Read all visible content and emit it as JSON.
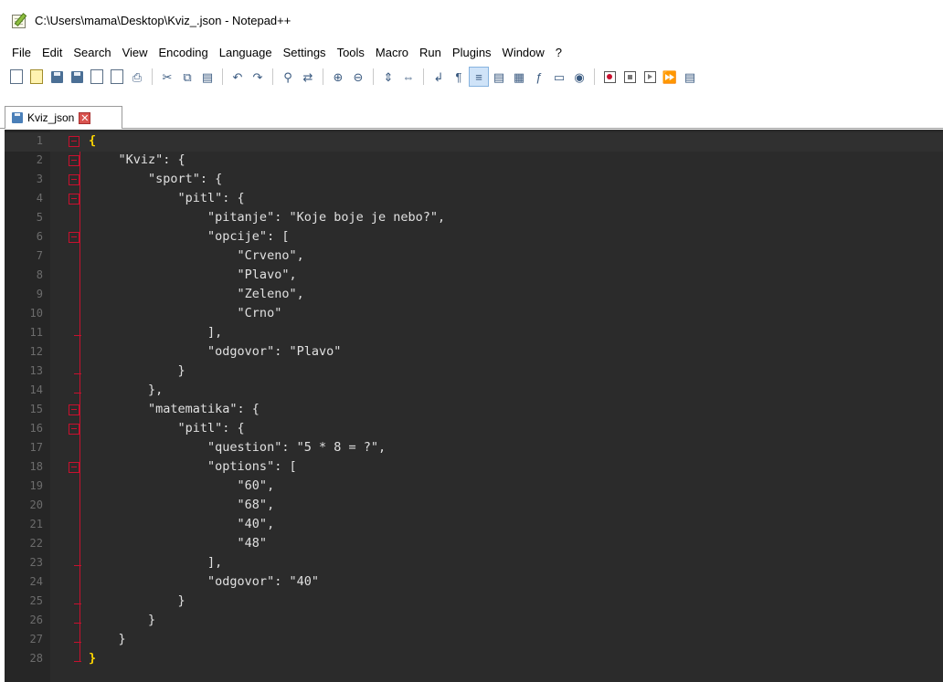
{
  "window": {
    "title": "C:\\Users\\mama\\Desktop\\Kviz_.json - Notepad++"
  },
  "menu": [
    "File",
    "Edit",
    "Search",
    "View",
    "Encoding",
    "Language",
    "Settings",
    "Tools",
    "Macro",
    "Run",
    "Plugins",
    "Window",
    "?"
  ],
  "toolbar": {
    "icons": [
      "new-file-icon",
      "open-file-icon",
      "save-icon",
      "save-all-icon",
      "close-icon",
      "close-all-icon",
      "print-icon",
      "cut-icon",
      "copy-icon",
      "paste-icon",
      "undo-icon",
      "redo-icon",
      "find-icon",
      "replace-icon",
      "zoom-in-icon",
      "zoom-out-icon",
      "sync-vertical-icon",
      "sync-horizontal-icon",
      "word-wrap-icon",
      "show-all-chars-icon",
      "indent-guide-icon",
      "user-language-icon",
      "document-map-icon",
      "function-list-icon",
      "folder-workspace-icon",
      "monitoring-icon",
      "record-macro-icon",
      "stop-recording-icon",
      "playback-macro-icon",
      "run-macro-multiple-icon",
      "save-macro-icon"
    ]
  },
  "tab": {
    "label": "Kviz_json",
    "close": "✕"
  },
  "editor": {
    "lines": [
      {
        "num": "1",
        "text": "{",
        "fold": "open"
      },
      {
        "num": "2",
        "text": "    \"Kviz\": {",
        "fold": "open"
      },
      {
        "num": "3",
        "text": "        \"sport\": {",
        "fold": "open"
      },
      {
        "num": "4",
        "text": "            \"pitl\": {",
        "fold": "open"
      },
      {
        "num": "5",
        "text": "                \"pitanje\": \"Koje boje je nebo?\",",
        "fold": ""
      },
      {
        "num": "6",
        "text": "                \"opcije\": [",
        "fold": "open"
      },
      {
        "num": "7",
        "text": "                    \"Crveno\",",
        "fold": ""
      },
      {
        "num": "8",
        "text": "                    \"Plavo\",",
        "fold": ""
      },
      {
        "num": "9",
        "text": "                    \"Zeleno\",",
        "fold": ""
      },
      {
        "num": "10",
        "text": "                    \"Crno\"",
        "fold": ""
      },
      {
        "num": "11",
        "text": "                ],",
        "fold": "end"
      },
      {
        "num": "12",
        "text": "                \"odgovor\": \"Plavo\"",
        "fold": ""
      },
      {
        "num": "13",
        "text": "            }",
        "fold": "end"
      },
      {
        "num": "14",
        "text": "        },",
        "fold": "end"
      },
      {
        "num": "15",
        "text": "        \"matematika\": {",
        "fold": "open"
      },
      {
        "num": "16",
        "text": "            \"pitl\": {",
        "fold": "open"
      },
      {
        "num": "17",
        "text": "                \"question\": \"5 * 8 = ?\",",
        "fold": ""
      },
      {
        "num": "18",
        "text": "                \"options\": [",
        "fold": "open"
      },
      {
        "num": "19",
        "text": "                    \"60\",",
        "fold": ""
      },
      {
        "num": "20",
        "text": "                    \"68\",",
        "fold": ""
      },
      {
        "num": "21",
        "text": "                    \"40\",",
        "fold": ""
      },
      {
        "num": "22",
        "text": "                    \"48\"",
        "fold": ""
      },
      {
        "num": "23",
        "text": "                ],",
        "fold": "end"
      },
      {
        "num": "24",
        "text": "                \"odgovor\": \"40\"",
        "fold": ""
      },
      {
        "num": "25",
        "text": "            }",
        "fold": "end"
      },
      {
        "num": "26",
        "text": "        }",
        "fold": "end"
      },
      {
        "num": "27",
        "text": "    }",
        "fold": "end"
      },
      {
        "num": "28",
        "text": "}",
        "fold": "end"
      }
    ]
  },
  "colors": {
    "editor_bg": "#2b2b2b",
    "gutter_bg": "#262626",
    "fold_marker": "#c8102e",
    "text": "#e0e0e0",
    "brace_highlight": "#ffd700"
  }
}
